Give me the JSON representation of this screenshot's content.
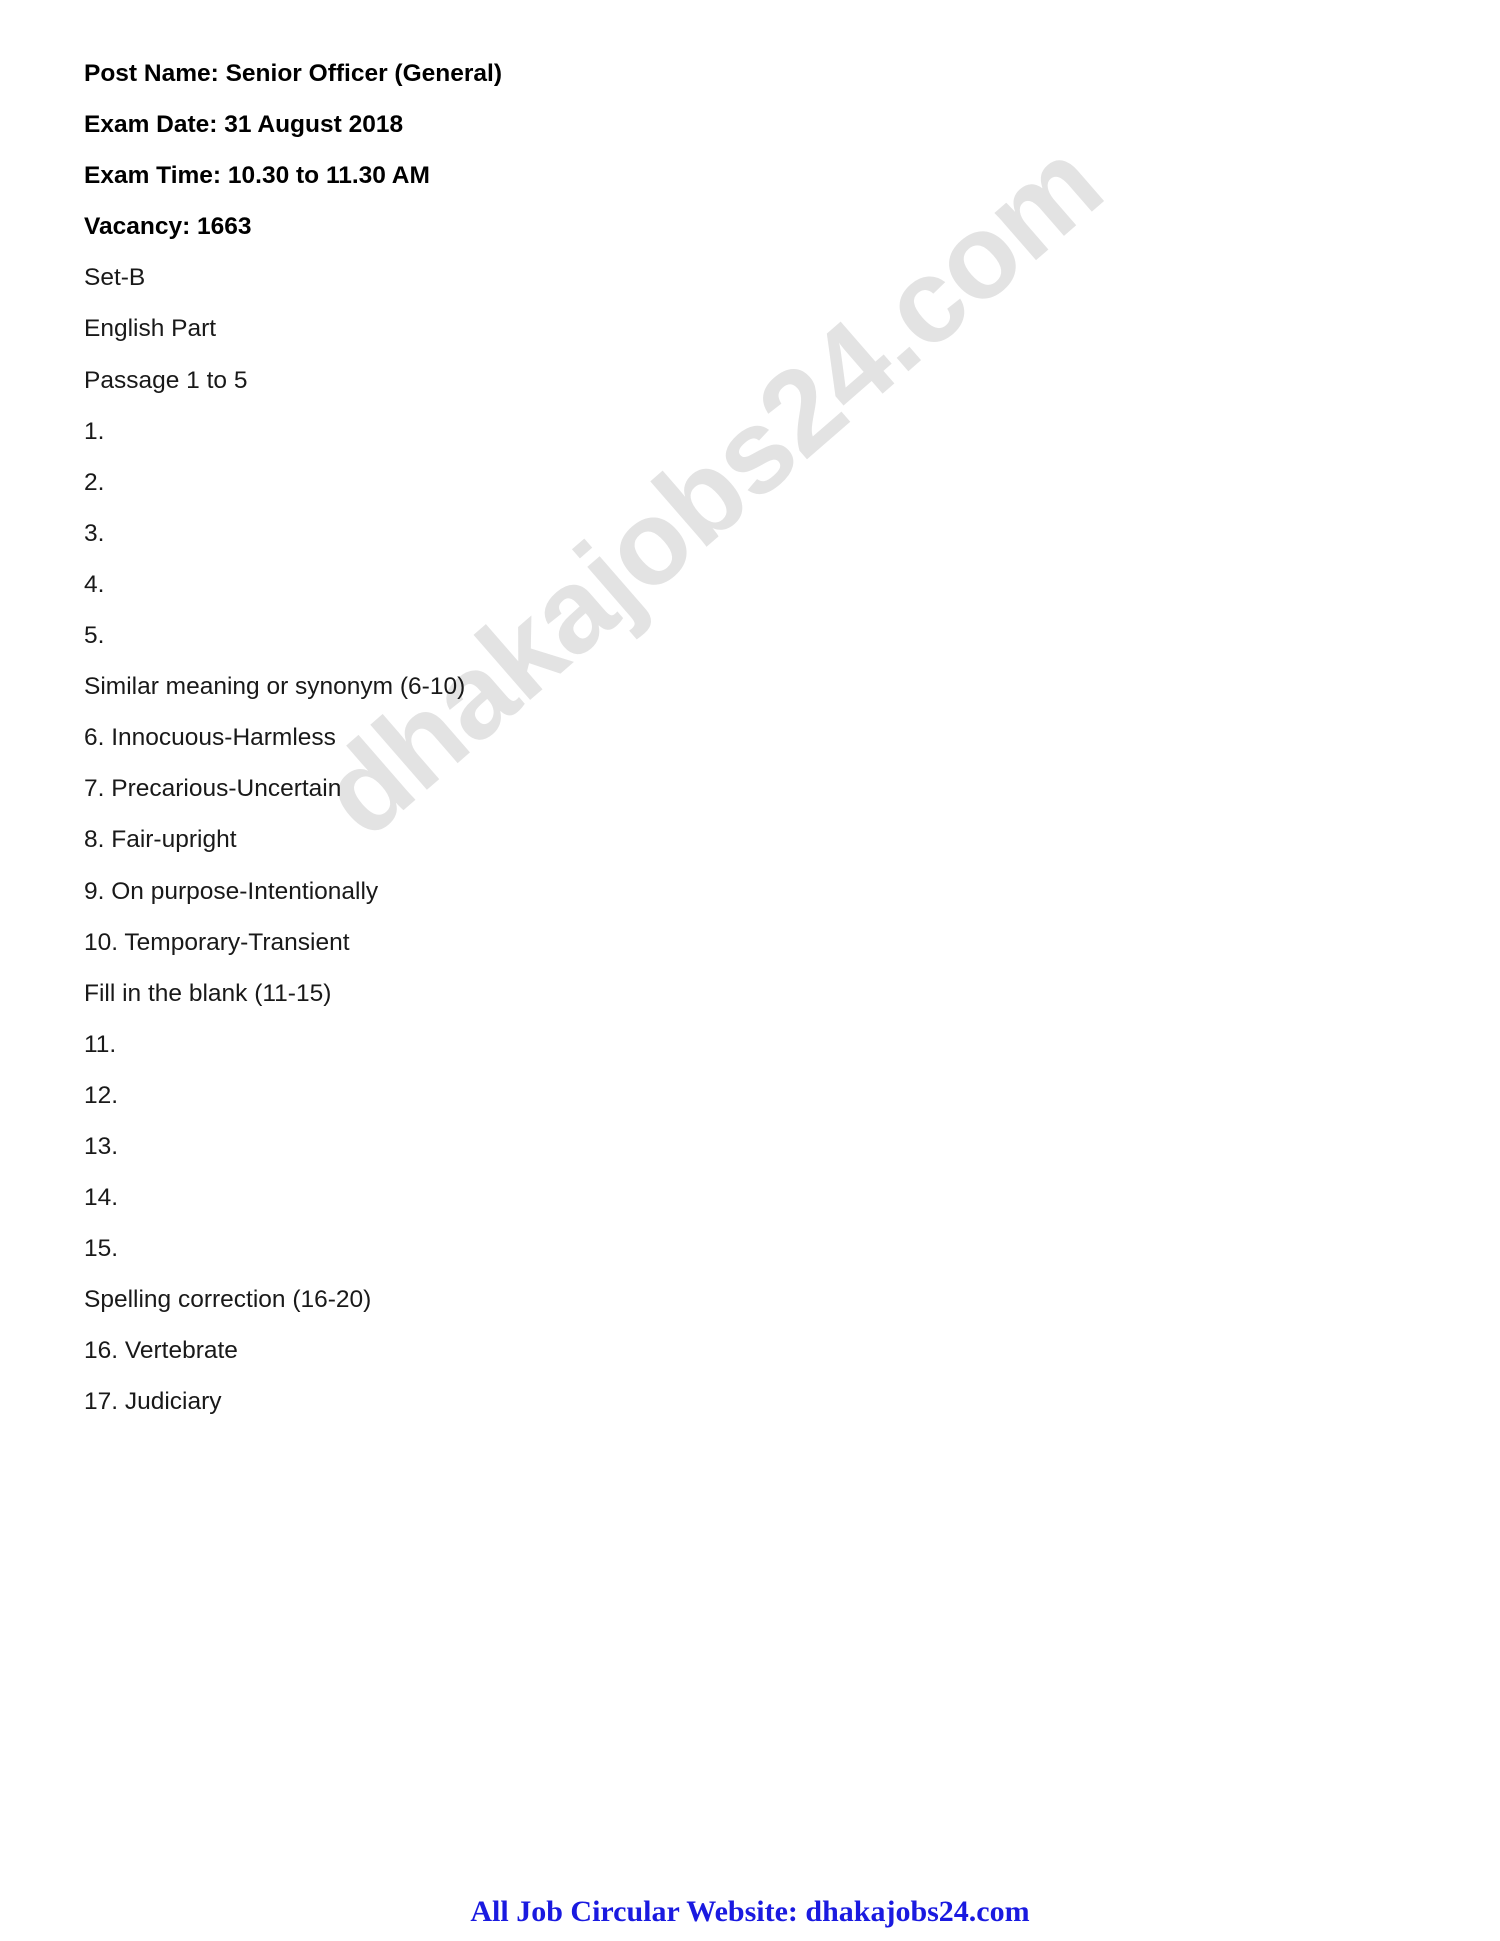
{
  "document": {
    "watermark": "dhakajobs24.com",
    "header_lines": [
      {
        "text": "Post Name: Senior Officer (General)",
        "bold": true
      },
      {
        "text": "Exam Date: 31 August 2018",
        "bold": true
      },
      {
        "text": "Exam Time: 10.30 to 11.30 AM",
        "bold": true
      },
      {
        "text": "Vacancy: 1663",
        "bold": true
      }
    ],
    "body_lines": [
      {
        "text": "Set-B",
        "bold": false
      },
      {
        "text": "English Part",
        "bold": false
      },
      {
        "text": "Passage 1 to 5",
        "bold": false
      },
      {
        "text": "1.",
        "bold": false
      },
      {
        "text": "2.",
        "bold": false
      },
      {
        "text": "3.",
        "bold": false
      },
      {
        "text": "4.",
        "bold": false
      },
      {
        "text": "5.",
        "bold": false
      },
      {
        "text": "Similar meaning or synonym (6-10)",
        "bold": false
      },
      {
        "text": "6. Innocuous-Harmless",
        "bold": false
      },
      {
        "text": "7. Precarious-Uncertain",
        "bold": false
      },
      {
        "text": "8. Fair-upright",
        "bold": false
      },
      {
        "text": "9. On purpose-Intentionally",
        "bold": false
      },
      {
        "text": "10. Temporary-Transient",
        "bold": false
      },
      {
        "text": "Fill in the blank (11-15)",
        "bold": false
      },
      {
        "text": "11.",
        "bold": false
      },
      {
        "text": "12.",
        "bold": false
      },
      {
        "text": "13.",
        "bold": false
      },
      {
        "text": "14.",
        "bold": false
      },
      {
        "text": "15.",
        "bold": false
      },
      {
        "text": "Spelling correction (16-20)",
        "bold": false
      },
      {
        "text": "16. Vertebrate",
        "bold": false
      },
      {
        "text": "17. Judiciary",
        "bold": false
      }
    ],
    "footer": {
      "text": "All Job Circular Website: dhakajobs24.com",
      "color": "#1a1ae0"
    }
  }
}
